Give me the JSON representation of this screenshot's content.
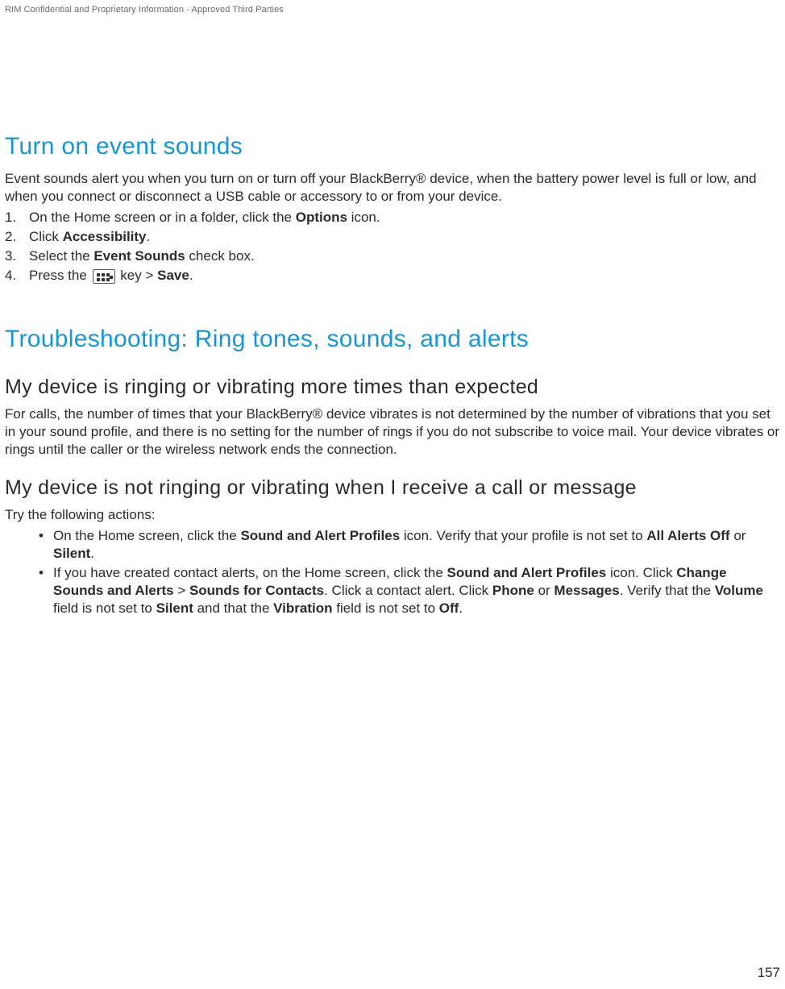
{
  "header": {
    "confidential": "RIM Confidential and Proprietary Information - Approved Third Parties"
  },
  "section1": {
    "title": "Turn on event sounds",
    "intro": "Event sounds alert you when you turn on or turn off your BlackBerry® device, when the battery power level is full or low, and when you connect or disconnect a USB cable or accessory to or from your device.",
    "step1_a": "On the Home screen or in a folder, click the ",
    "step1_b": "Options",
    "step1_c": " icon.",
    "step2_a": "Click ",
    "step2_b": "Accessibility",
    "step2_c": ".",
    "step3_a": "Select the ",
    "step3_b": "Event Sounds",
    "step3_c": " check box.",
    "step4_a": "Press the ",
    "step4_b": " key > ",
    "step4_c": "Save",
    "step4_d": "."
  },
  "section2": {
    "title": "Troubleshooting: Ring tones, sounds, and alerts",
    "sub1": {
      "title": "My device is ringing or vibrating more times than expected",
      "body": "For calls, the number of times that your BlackBerry® device vibrates is not determined by the number of vibrations that you set in your sound profile, and there is no setting for the number of rings if you do not subscribe to voice mail. Your device vibrates or rings until the caller or the wireless network ends the connection."
    },
    "sub2": {
      "title": "My device is not ringing or vibrating when I receive a call or message",
      "intro": "Try the following actions:",
      "bullet1_a": "On the Home screen, click the ",
      "bullet1_b": "Sound and Alert Profiles",
      "bullet1_c": " icon. Verify that your profile is not set to ",
      "bullet1_d": "All Alerts Off",
      "bullet1_e": " or ",
      "bullet1_f": "Silent",
      "bullet1_g": ".",
      "bullet2_a": "If you have created contact alerts, on the Home screen, click the ",
      "bullet2_b": "Sound and Alert Profiles",
      "bullet2_c": " icon. Click ",
      "bullet2_d": "Change Sounds and Alerts",
      "bullet2_e": " > ",
      "bullet2_f": "Sounds for Contacts",
      "bullet2_g": ". Click a contact alert. Click ",
      "bullet2_h": "Phone",
      "bullet2_i": " or ",
      "bullet2_j": "Messages",
      "bullet2_k": ". Verify that the ",
      "bullet2_l": "Volume",
      "bullet2_m": " field is not set to ",
      "bullet2_n": "Silent",
      "bullet2_o": " and that the ",
      "bullet2_p": "Vibration",
      "bullet2_q": " field is not set to ",
      "bullet2_r": "Off",
      "bullet2_s": "."
    }
  },
  "page_number": "157"
}
